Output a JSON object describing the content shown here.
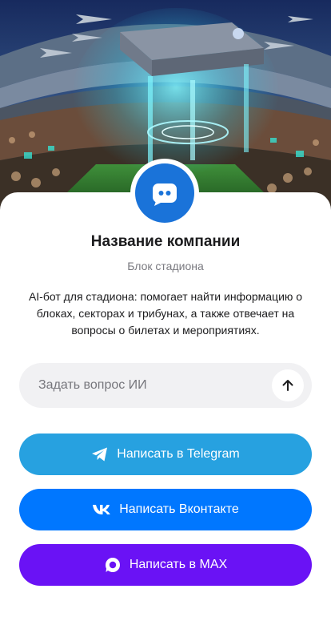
{
  "hero": {
    "image": "stadium-futuristic-illustration"
  },
  "profile": {
    "avatar_icon": "chat-bot-icon",
    "company_name": "Название компании",
    "subtitle": "Блок стадиона",
    "description": "AI-бот для стадиона: помогает найти информацию о блоках, секторах и трибунах, а также отвечает на вопросы о билетах и мероприятиях."
  },
  "ask": {
    "placeholder": "Задать вопрос ИИ",
    "value": "",
    "send_icon": "arrow-up-icon"
  },
  "actions": [
    {
      "label": "Написать в Telegram",
      "icon": "telegram-icon",
      "color": "#27a1e0"
    },
    {
      "label": "Написать Вконтакте",
      "icon": "vk-icon",
      "color": "#0077ff"
    },
    {
      "label": "Написать в MAX",
      "icon": "max-icon",
      "color": "#6a12f5"
    }
  ],
  "colors": {
    "avatar": "#1a73d9",
    "ask_background": "#f1f1f3"
  }
}
